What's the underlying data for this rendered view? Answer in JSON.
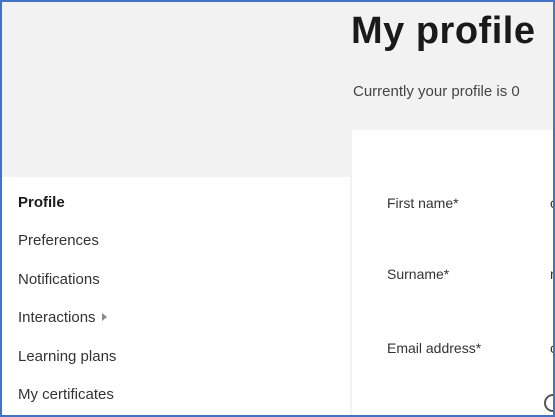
{
  "page": {
    "title": "My profile",
    "status_text": "Currently your profile is 0"
  },
  "sidebar": {
    "items": [
      {
        "label": "Profile",
        "active": true
      },
      {
        "label": "Preferences",
        "active": false
      },
      {
        "label": "Notifications",
        "active": false
      },
      {
        "label": "Interactions",
        "active": false,
        "icon": "caret-right-icon"
      },
      {
        "label": "Learning plans",
        "active": false
      },
      {
        "label": "My certificates",
        "active": false
      }
    ]
  },
  "form": {
    "fields": [
      {
        "label": "First name*",
        "value_visible": "c"
      },
      {
        "label": "Surname*",
        "value_visible": "r"
      },
      {
        "label": "Email address*",
        "value_visible": "c"
      }
    ],
    "partial_icon": "help-circle-icon"
  },
  "colors": {
    "frame_border": "#4472c4",
    "page_background": "#f2f2f2",
    "card_background": "#ffffff"
  }
}
